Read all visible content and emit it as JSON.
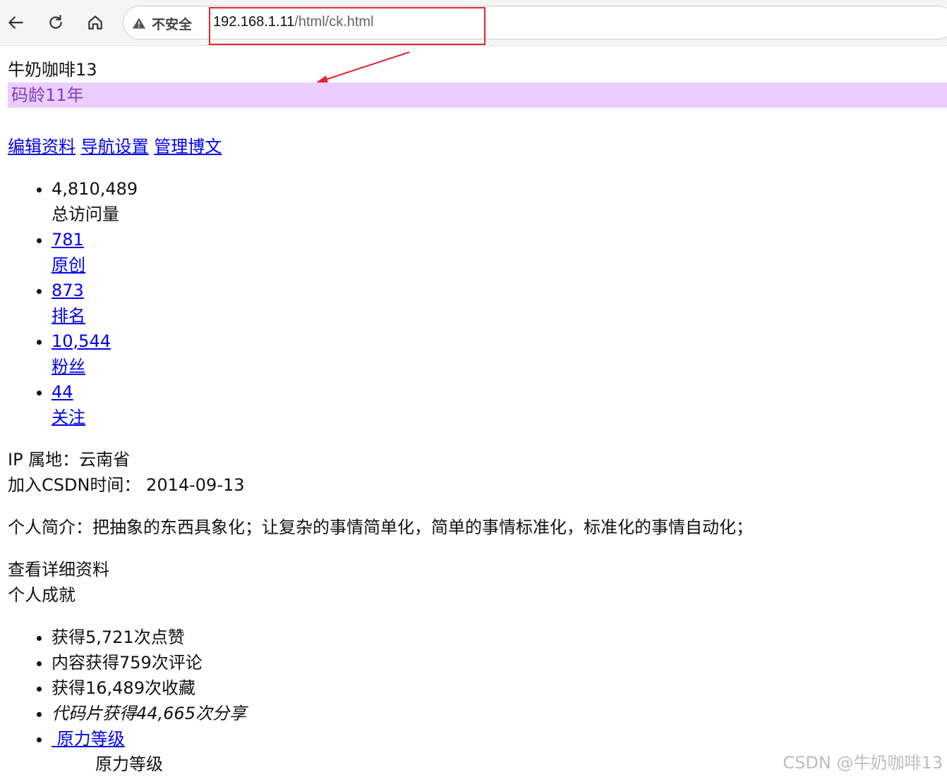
{
  "browser": {
    "security_label": "不安全",
    "url_host": "192.168.1.11",
    "url_path": "/html/ck.html"
  },
  "profile": {
    "name": "牛奶咖啡13",
    "code_age": "码龄11年",
    "links": [
      "编辑资料",
      "导航设置",
      "管理博文"
    ],
    "stats": [
      {
        "value": "4,810,489",
        "label": "总访问量",
        "link": false
      },
      {
        "value": "781",
        "label": "原创",
        "link": true
      },
      {
        "value": "873",
        "label": "排名",
        "link": true
      },
      {
        "value": "10,544",
        "label": "粉丝",
        "link": true
      },
      {
        "value": "44",
        "label": "关注",
        "link": true
      }
    ],
    "ip_location": "IP 属地：云南省",
    "join_date": "加入CSDN时间： 2014-09-13",
    "intro": "个人简介：把抽象的东西具象化；让复杂的事情简单化，简单的事情标准化，标准化的事情自动化；",
    "view_detail": "查看详细资料",
    "achievements_title": "个人成就",
    "achievements": [
      "获得5,721次点赞",
      "内容获得759次评论",
      "获得16,489次收藏",
      "代码片获得44,665次分享"
    ],
    "level_link": " 原力等级",
    "level_label": "原力等级"
  },
  "watermark": "CSDN @牛奶咖啡13",
  "colors": {
    "highlight_border": "#e0262e",
    "code_age_bg": "#eccdfe",
    "code_age_text": "#7a3fc0",
    "link": "#0000ee"
  }
}
